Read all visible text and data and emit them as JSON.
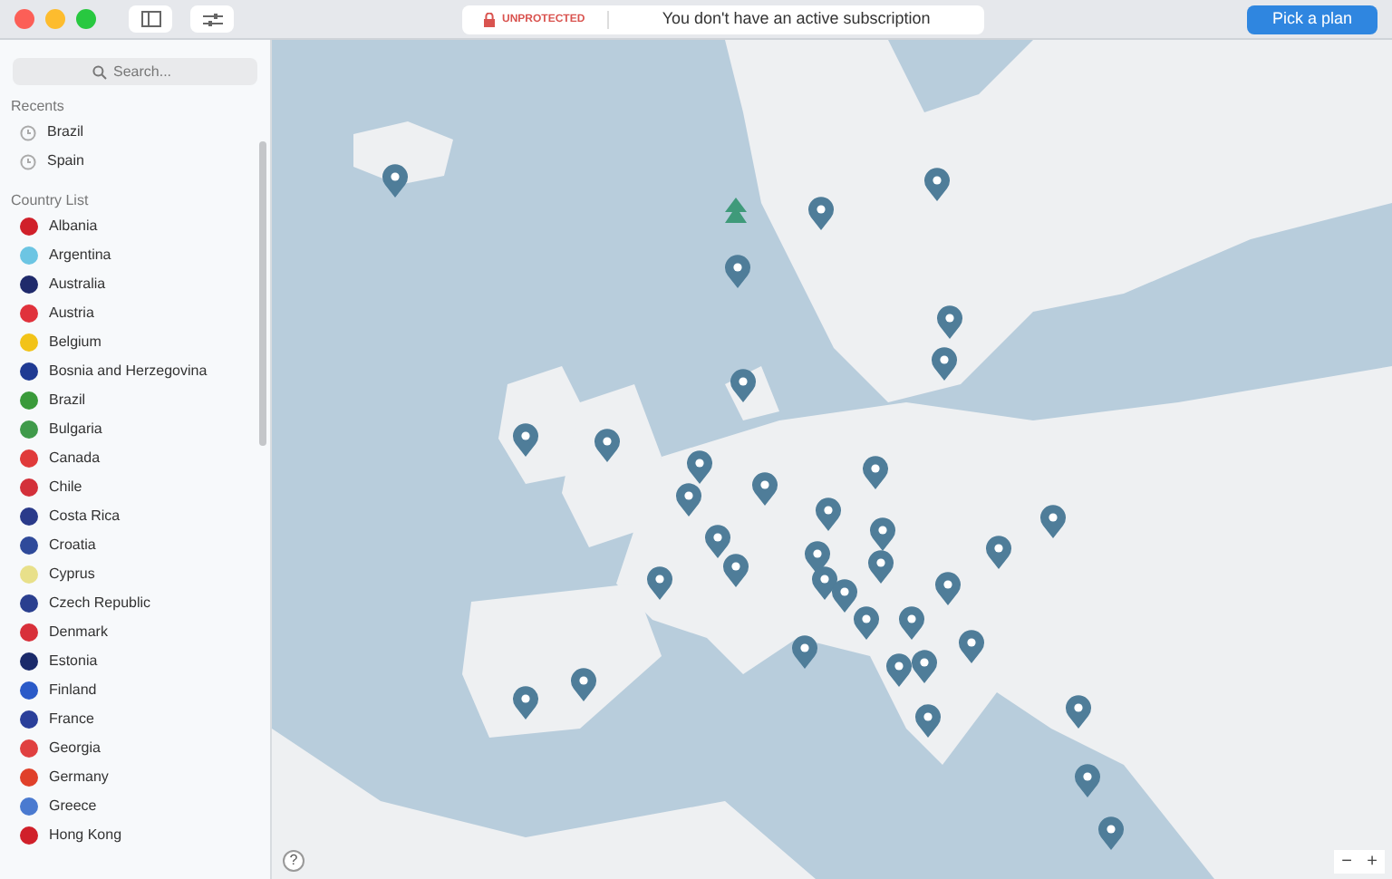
{
  "toolbar": {
    "status": "UNPROTECTED",
    "message": "You don't have an active subscription",
    "action_button": "Pick a plan"
  },
  "sidebar": {
    "search": {
      "placeholder": "Search..."
    },
    "recents_heading": "Recents",
    "recents": [
      "Brazil",
      "Spain"
    ],
    "country_list_heading": "Country List",
    "countries": [
      {
        "name": "Albania",
        "color": "#d0202a"
      },
      {
        "name": "Argentina",
        "color": "#6cc5e3"
      },
      {
        "name": "Australia",
        "color": "#1f2a6b"
      },
      {
        "name": "Austria",
        "color": "#e0323c"
      },
      {
        "name": "Belgium",
        "color": "#f2c318"
      },
      {
        "name": "Bosnia and Herzegovina",
        "color": "#1f3a93"
      },
      {
        "name": "Brazil",
        "color": "#3a9a3a"
      },
      {
        "name": "Bulgaria",
        "color": "#3f9a4a"
      },
      {
        "name": "Canada",
        "color": "#e03a3a"
      },
      {
        "name": "Chile",
        "color": "#d3303a"
      },
      {
        "name": "Costa Rica",
        "color": "#2a3a8a"
      },
      {
        "name": "Croatia",
        "color": "#2f4a9a"
      },
      {
        "name": "Cyprus",
        "color": "#e8e08a"
      },
      {
        "name": "Czech Republic",
        "color": "#2a3f8f"
      },
      {
        "name": "Denmark",
        "color": "#d8303a"
      },
      {
        "name": "Estonia",
        "color": "#1a2a6a"
      },
      {
        "name": "Finland",
        "color": "#2a5ac8"
      },
      {
        "name": "France",
        "color": "#2a3f9a"
      },
      {
        "name": "Georgia",
        "color": "#e04040"
      },
      {
        "name": "Germany",
        "color": "#e0402a"
      },
      {
        "name": "Greece",
        "color": "#4a7ad0"
      },
      {
        "name": "Hong Kong",
        "color": "#d0202a"
      }
    ]
  },
  "map": {
    "help": "?",
    "zoom_out": "−",
    "zoom_in": "+"
  }
}
